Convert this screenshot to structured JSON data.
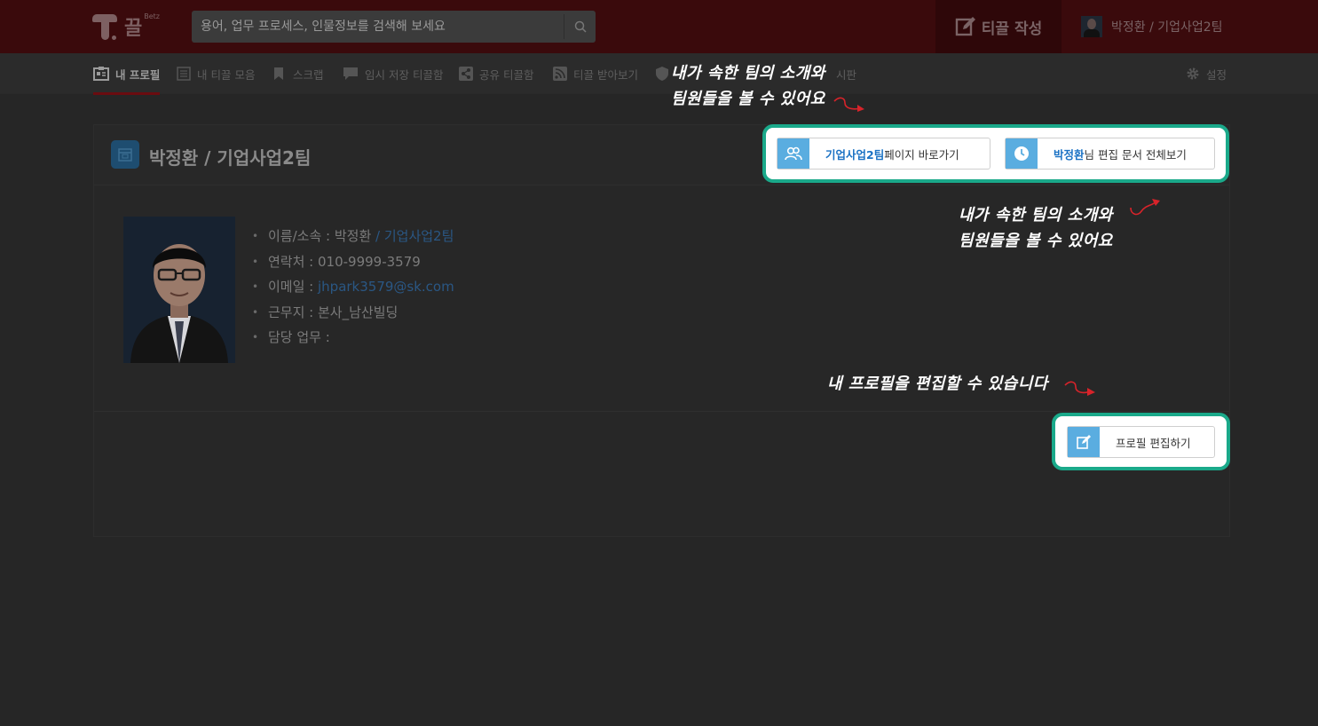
{
  "header": {
    "logo_text": "끌",
    "logo_sup": "Betz",
    "search_placeholder": "용어, 업무 프로세스, 인물정보를 검색해 보세요",
    "write_button": "티끌 작성",
    "user_label": "박정환 / 기업사업2팀"
  },
  "nav": {
    "items": [
      {
        "label": "내 프로필",
        "icon": "profile-card-icon"
      },
      {
        "label": "내 티끌 모음",
        "icon": "list-icon"
      },
      {
        "label": "스크랩",
        "icon": "bookmark-icon"
      },
      {
        "label": "임시 저장 티끌함",
        "icon": "chat-icon"
      },
      {
        "label": "공유 티끌함",
        "icon": "share-icon"
      },
      {
        "label": "티끌 받아보기",
        "icon": "rss-icon"
      },
      {
        "label": "시판",
        "icon": "shield-icon"
      }
    ],
    "settings_label": "설정"
  },
  "profile": {
    "title": "박정환 / 기업사업2팀",
    "team_button_team": "기업사업2팀",
    "team_button_rest": " 페이지 바로가기",
    "docs_button_name": "박정환",
    "docs_button_rest": "님 편집 문서 전체보기",
    "fields": {
      "name_label": "이름/소속 : ",
      "name_value": "박정환",
      "name_team": " / 기업사업2팀",
      "phone_label": "연락처 : ",
      "phone_value": "010-9999-3579",
      "email_label": "이메일 : ",
      "email_value": "jhpark3579@sk.com",
      "location_label": "근무지 : ",
      "location_value": "본사_남산빌딩",
      "duty_label": "담당 업무 : ",
      "duty_value": ""
    },
    "edit_button": "프로필 편집하기"
  },
  "callouts": {
    "note1_line1": "내가 속한 팀의 소개와",
    "note1_line2": "팀원들을 볼 수 있어요",
    "note2_line1": "내가 속한 팀의 소개와",
    "note2_line2": "팀원들을 볼 수 있어요",
    "note3": "내 프로필을 편집할 수 있습니다"
  },
  "colors": {
    "highlight": "#1aa98a",
    "accent_blue": "#1b72c4",
    "icon_blue": "#5aade0",
    "header_red": "#3a0a0c"
  }
}
